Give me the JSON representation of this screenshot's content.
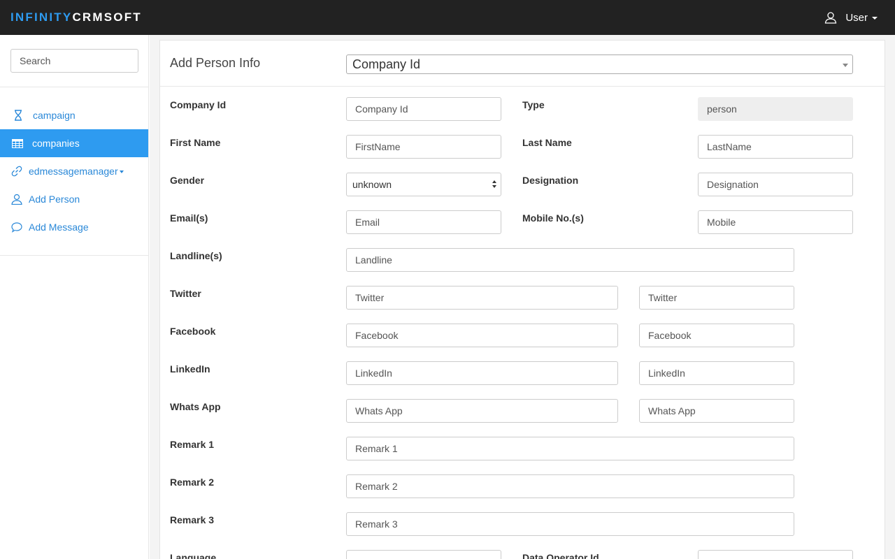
{
  "brand": {
    "part1": "INFINITY",
    "part2": "CRMSOFT"
  },
  "user_menu": {
    "label": "User"
  },
  "sidebar": {
    "search_placeholder": "Search",
    "items": [
      {
        "label": "campaign",
        "icon": "hourglass-icon"
      },
      {
        "label": "companies",
        "icon": "table-icon"
      },
      {
        "label": "edmessagemanager",
        "icon": "link-icon"
      },
      {
        "label": "Add Person",
        "icon": "user-icon"
      },
      {
        "label": "Add Message",
        "icon": "comment-icon"
      }
    ]
  },
  "panel": {
    "title": "Add Person Info",
    "company_select": "Company Id"
  },
  "form": {
    "company_id": {
      "label": "Company Id",
      "placeholder": "Company Id"
    },
    "type": {
      "label": "Type",
      "value": "person"
    },
    "first_name": {
      "label": "First Name",
      "placeholder": "FirstName"
    },
    "last_name": {
      "label": "Last Name",
      "placeholder": "LastName"
    },
    "gender": {
      "label": "Gender",
      "value": "unknown"
    },
    "designation": {
      "label": "Designation",
      "placeholder": "Designation"
    },
    "email": {
      "label": "Email(s)",
      "placeholder": "Email"
    },
    "mobile": {
      "label": "Mobile No.(s)",
      "placeholder": "Mobile"
    },
    "landline": {
      "label": "Landline(s)",
      "placeholder": "Landline"
    },
    "twitter": {
      "label": "Twitter",
      "placeholder": "Twitter",
      "placeholder2": "Twitter"
    },
    "facebook": {
      "label": "Facebook",
      "placeholder": "Facebook",
      "placeholder2": "Facebook"
    },
    "linkedin": {
      "label": "LinkedIn",
      "placeholder": "LinkedIn",
      "placeholder2": "LinkedIn"
    },
    "whatsapp": {
      "label": "Whats App",
      "placeholder": "Whats App",
      "placeholder2": "Whats App"
    },
    "remark1": {
      "label": "Remark 1",
      "placeholder": "Remark 1"
    },
    "remark2": {
      "label": "Remark 2",
      "placeholder": "Remark 2"
    },
    "remark3": {
      "label": "Remark 3",
      "placeholder": "Remark 3"
    },
    "language": {
      "label": "Language"
    },
    "data_operator": {
      "label": "Data Operator Id"
    }
  }
}
